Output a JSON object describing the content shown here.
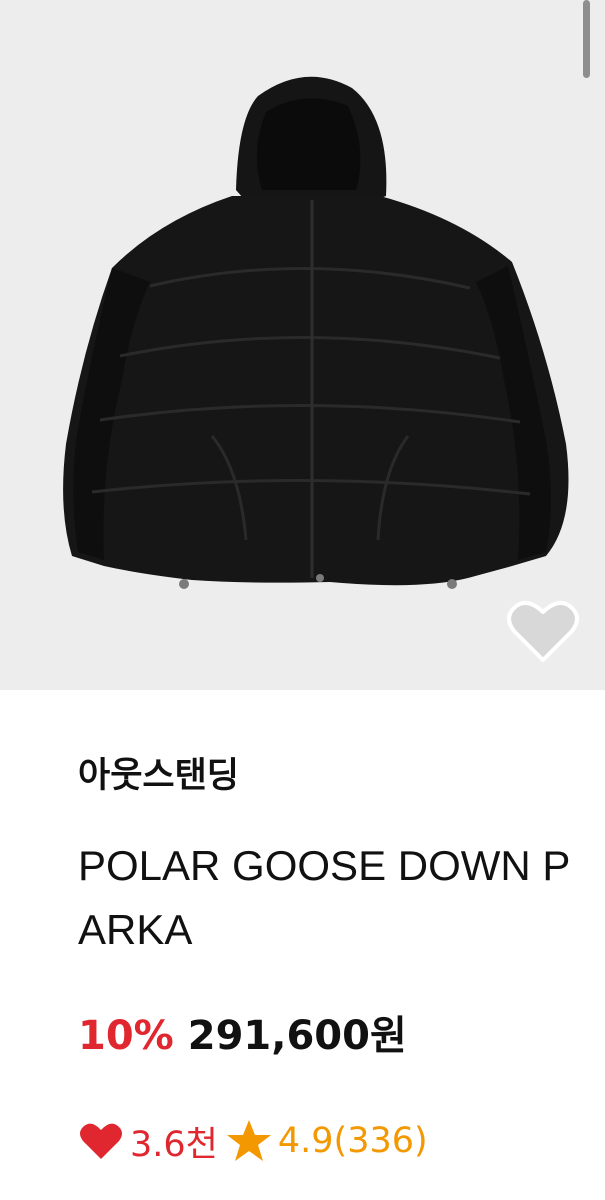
{
  "product": {
    "brand": "아웃스탠딩",
    "name": "POLAR GOOSE DOWN PARKA",
    "discount": "10%",
    "price": "291,600원",
    "likes": "3.6천",
    "rating": "4.9(336)"
  },
  "colors": {
    "discount": "#e0262e",
    "heart": "#e0262e",
    "star": "#f39800",
    "image_background": "#ededed"
  },
  "icons": {
    "wishlist": "heart-outline-icon",
    "likes": "heart-icon",
    "rating": "star-icon"
  }
}
